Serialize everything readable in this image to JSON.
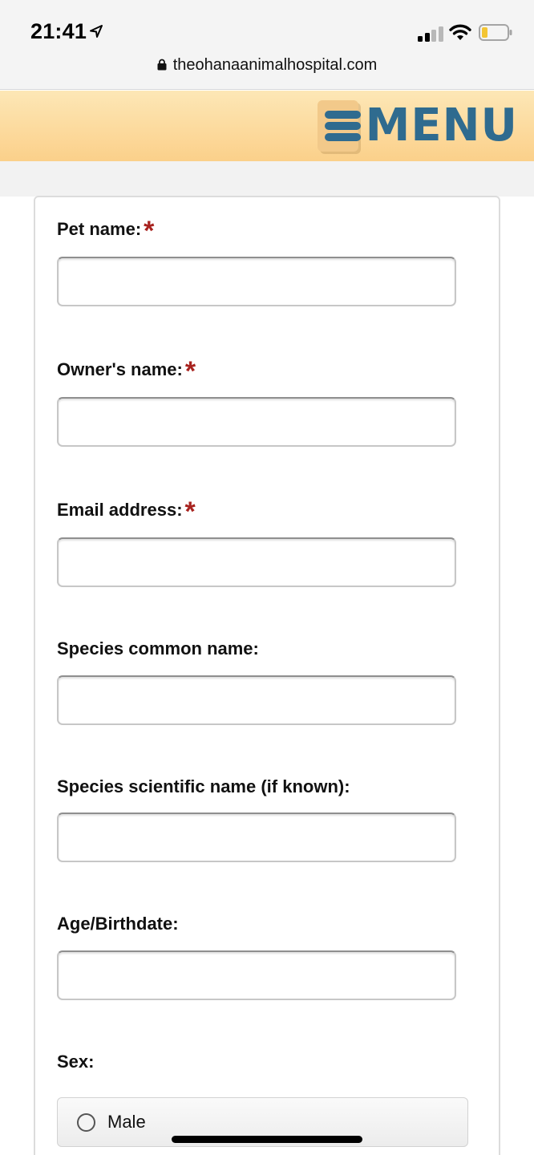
{
  "status_bar": {
    "time": "21:41",
    "icons": [
      "location-arrow-icon",
      "cellular-signal-icon",
      "wifi-icon",
      "battery-icon"
    ],
    "battery_color": "#f3c533"
  },
  "browser": {
    "url": "theohanaanimalhospital.com"
  },
  "header": {
    "menu_label": "MENU",
    "background_color": "#fbd08a",
    "brand_color": "#2f6b8f"
  },
  "form": {
    "required_color": "#a8231f",
    "fields": [
      {
        "label": "Pet name:",
        "required_mark": "*",
        "value": ""
      },
      {
        "label": "Owner's name:",
        "required_mark": "*",
        "value": ""
      },
      {
        "label": "Email address:",
        "required_mark": "*",
        "value": ""
      },
      {
        "label": "Species common name:",
        "value": ""
      },
      {
        "label": "Species scientific name (if known):",
        "value": ""
      },
      {
        "label": "Age/Birthdate:",
        "value": ""
      }
    ],
    "sex": {
      "label": "Sex:",
      "options": [
        {
          "label": "Male",
          "selected": false
        }
      ]
    }
  }
}
